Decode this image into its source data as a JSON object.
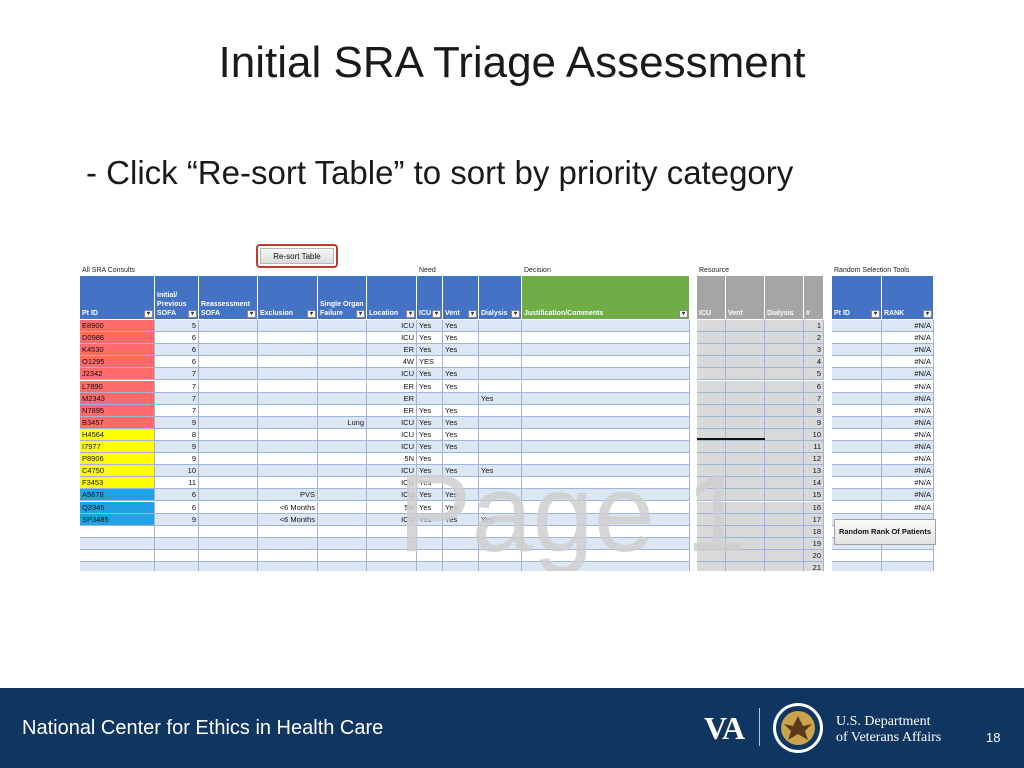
{
  "slide": {
    "title": "Initial SRA Triage Assessment",
    "bullet": "- Click “Re-sort Table” to sort by priority category",
    "watermark": "Page 1"
  },
  "spreadsheet": {
    "sections": {
      "consults": "All SRA Consults",
      "need": "Need",
      "decision": "Decision",
      "resource": "Resource",
      "random": "Random Selection Tools"
    },
    "buttons": {
      "resort": "Re-sort Table",
      "random_rank": "Random Rank Of Patients"
    },
    "headers": {
      "pt_id": "Pt ID",
      "initial_sofa": "Initial/\nPrevious\nSOFA",
      "reassessment_sofa": "Reassessment\nSOFA",
      "exclusion": "Exclusion",
      "single_organ": "Single Organ\nFailure",
      "location": "Location",
      "icu": "ICU",
      "vent": "Vent",
      "dialysis": "Dialysis",
      "justification": "Justification/Comments",
      "res_icu": "ICU",
      "res_vent": "Vent",
      "res_dialysis": "Dialysis",
      "num": "#",
      "rand_pt_id": "Pt ID",
      "rank": "RANK"
    },
    "colors": {
      "red": "#ff6b6b",
      "yellow": "#ffff00",
      "blue": "#1fa3e6",
      "header": "#4472c4",
      "green_header": "#70ad47",
      "grey_header": "#a5a5a5",
      "highlight": "#c0392b"
    },
    "rows": [
      {
        "id": "E8900",
        "color": "red",
        "sofa": "5",
        "exclusion": "",
        "organ": "",
        "location": "ICU",
        "icu": "Yes",
        "vent": "Yes",
        "dialysis": "",
        "num": "1",
        "rank": "#N/A"
      },
      {
        "id": "D0986",
        "color": "red",
        "sofa": "6",
        "exclusion": "",
        "organ": "",
        "location": "ICU",
        "icu": "Yes",
        "vent": "Yes",
        "dialysis": "",
        "num": "2",
        "rank": "#N/A"
      },
      {
        "id": "K4530",
        "color": "red",
        "sofa": "6",
        "exclusion": "",
        "organ": "",
        "location": "ER",
        "icu": "Yes",
        "vent": "Yes",
        "dialysis": "",
        "num": "3",
        "rank": "#N/A"
      },
      {
        "id": "O1295",
        "color": "red",
        "sofa": "6",
        "exclusion": "",
        "organ": "",
        "location": "4W",
        "icu": "YES",
        "vent": "",
        "dialysis": "",
        "num": "4",
        "rank": "#N/A"
      },
      {
        "id": "J2342",
        "color": "red",
        "sofa": "7",
        "exclusion": "",
        "organ": "",
        "location": "ICU",
        "icu": "Yes",
        "vent": "Yes",
        "dialysis": "",
        "num": "5",
        "rank": "#N/A"
      },
      {
        "id": "L7890",
        "color": "red",
        "sofa": "7",
        "exclusion": "",
        "organ": "",
        "location": "ER",
        "icu": "Yes",
        "vent": "Yes",
        "dialysis": "",
        "num": "6",
        "rank": "#N/A"
      },
      {
        "id": "M2343",
        "color": "red",
        "sofa": "7",
        "exclusion": "",
        "organ": "",
        "location": "ER",
        "icu": "",
        "vent": "",
        "dialysis": "Yes",
        "num": "7",
        "rank": "#N/A"
      },
      {
        "id": "N7895",
        "color": "red",
        "sofa": "7",
        "exclusion": "",
        "organ": "",
        "location": "ER",
        "icu": "Yes",
        "vent": "Yes",
        "dialysis": "",
        "num": "8",
        "rank": "#N/A"
      },
      {
        "id": "B3457",
        "color": "red",
        "sofa": "9",
        "exclusion": "",
        "organ": "Lung",
        "location": "ICU",
        "icu": "Yes",
        "vent": "Yes",
        "dialysis": "",
        "num": "9",
        "rank": "#N/A"
      },
      {
        "id": "H4564",
        "color": "yellow",
        "sofa": "8",
        "exclusion": "",
        "organ": "",
        "location": "ICU",
        "icu": "Yes",
        "vent": "Yes",
        "dialysis": "",
        "num": "10",
        "rank": "#N/A"
      },
      {
        "id": "I7977",
        "color": "yellow",
        "sofa": "9",
        "exclusion": "",
        "organ": "",
        "location": "ICU",
        "icu": "Yes",
        "vent": "Yes",
        "dialysis": "",
        "num": "11",
        "rank": "#N/A"
      },
      {
        "id": "P8906",
        "color": "yellow",
        "sofa": "9",
        "exclusion": "",
        "organ": "",
        "location": "5N",
        "icu": "Yes",
        "vent": "",
        "dialysis": "",
        "num": "12",
        "rank": "#N/A"
      },
      {
        "id": "C4750",
        "color": "yellow",
        "sofa": "10",
        "exclusion": "",
        "organ": "",
        "location": "ICU",
        "icu": "Yes",
        "vent": "Yes",
        "dialysis": "Yes",
        "num": "13",
        "rank": "#N/A"
      },
      {
        "id": "F3453",
        "color": "yellow",
        "sofa": "11",
        "exclusion": "",
        "organ": "",
        "location": "ICU",
        "icu": "Yes",
        "vent": "",
        "dialysis": "",
        "num": "14",
        "rank": "#N/A"
      },
      {
        "id": "A5678",
        "color": "blue",
        "sofa": "6",
        "exclusion": "PVS",
        "organ": "",
        "location": "ICU",
        "icu": "Yes",
        "vent": "Yes",
        "dialysis": "",
        "num": "15",
        "rank": "#N/A"
      },
      {
        "id": "Q2345",
        "color": "blue",
        "sofa": "6",
        "exclusion": "<6 Months",
        "organ": "",
        "location": "5N",
        "icu": "Yes",
        "vent": "Yes",
        "dialysis": "",
        "num": "16",
        "rank": "#N/A"
      },
      {
        "id": "SP3485",
        "color": "blue",
        "sofa": "9",
        "exclusion": "<6 Months",
        "organ": "",
        "location": "ICU",
        "icu": "Yes",
        "vent": "Yes",
        "dialysis": "Yes",
        "num": "17",
        "rank": ""
      },
      {
        "id": "",
        "color": "",
        "sofa": "",
        "exclusion": "",
        "organ": "",
        "location": "",
        "icu": "",
        "vent": "",
        "dialysis": "",
        "num": "18",
        "rank": ""
      },
      {
        "id": "",
        "color": "",
        "sofa": "",
        "exclusion": "",
        "organ": "",
        "location": "",
        "icu": "",
        "vent": "",
        "dialysis": "",
        "num": "19",
        "rank": ""
      },
      {
        "id": "",
        "color": "",
        "sofa": "",
        "exclusion": "",
        "organ": "",
        "location": "",
        "icu": "",
        "vent": "",
        "dialysis": "",
        "num": "20",
        "rank": ""
      },
      {
        "id": "",
        "color": "",
        "sofa": "",
        "exclusion": "",
        "organ": "",
        "location": "",
        "icu": "",
        "vent": "",
        "dialysis": "",
        "num": "21",
        "rank": ""
      }
    ]
  },
  "footer": {
    "org_name": "National Center for Ethics in Health Care",
    "logo": "VA",
    "dept_line1": "U.S. Department",
    "dept_line2": "of Veterans Affairs",
    "page_number": "18",
    "seal_icon": "va-seal-icon"
  }
}
